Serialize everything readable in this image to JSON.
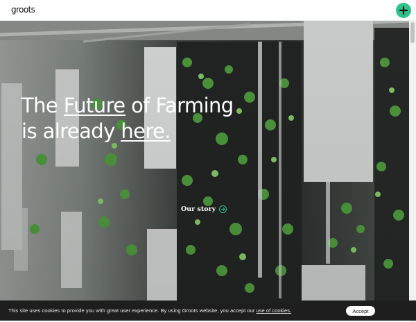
{
  "header": {
    "logo_text": "groots",
    "add_icon": "plus-icon"
  },
  "hero": {
    "headline_line1_prefix": "The ",
    "headline_line1_link": "Future",
    "headline_line1_suffix": " of Farming",
    "headline_line2_prefix": "is already ",
    "headline_line2_link": "here.",
    "cta_label": "Our story",
    "cta_icon": "arrow-right-circle-icon"
  },
  "cookie_bar": {
    "message": "This site uses cookies to provide you with great user experience. By using Groots website, you accept our ",
    "link_text": "use of cookies.",
    "accept_label": "Accept"
  },
  "colors": {
    "accent": "#2ec38b",
    "cookie_bg": "#1e1e1e"
  }
}
